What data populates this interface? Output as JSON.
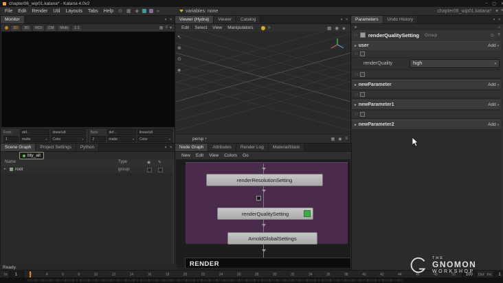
{
  "icons": {
    "minimize": "–",
    "maximize": "▢",
    "close": "✕",
    "menu": "≡",
    "dropdown": "▾",
    "expand": "▸",
    "chevrons": "»",
    "grid": "▦",
    "target": "◉",
    "diamond": "◈",
    "select_arrow": "↖",
    "plus": "⊕",
    "circle_dot": "⊙",
    "grip": "∷",
    "pencil": "✎"
  },
  "window": {
    "title": "chapter06_wip01.katana* - Katana 4.0v2"
  },
  "menubar": {
    "items": [
      "File",
      "Edit",
      "Render",
      "Util",
      "Layouts",
      "Tabs",
      "Help"
    ],
    "variables_label": "variables: none",
    "project_label": "chapter06_wip01.katana*"
  },
  "monitor": {
    "tab": "Monitor",
    "buttons": [
      "2D",
      "3D",
      "ROI",
      "CM",
      "Multi",
      "1:1"
    ],
    "front": {
      "label": "Front",
      "frame": "1",
      "view": "def...",
      "colorspace": "linear/u8",
      "matte": "matte",
      "color": "Color"
    },
    "back": {
      "label": "Back",
      "frame": "2",
      "view": "def...",
      "colorspace": "linear/u8",
      "matte": "matte",
      "color": "Color"
    }
  },
  "viewer": {
    "tabs": [
      "Viewer (Hydra)",
      "Viewer",
      "Catalog"
    ],
    "menu": [
      "Edit",
      "Select",
      "View",
      "Manipulators"
    ],
    "camera": "persp"
  },
  "scenegraph": {
    "tabs": [
      "Scene Graph",
      "Project Settings",
      "Python"
    ],
    "filter": "bty_all",
    "col_name": "Name",
    "col_type": "Type",
    "root": {
      "name": "root",
      "type": "group"
    }
  },
  "nodegraph": {
    "tabs": [
      "Node Graph",
      "Attributes",
      "Render Log",
      "MaterialStack"
    ],
    "menu": [
      "New",
      "Edit",
      "View",
      "Colors",
      "Go"
    ],
    "nodes": [
      "renderResolutionSetting",
      "renderQualitySetting",
      "ArnoldGlobalSettings"
    ],
    "render_label": "RENDER"
  },
  "parameters": {
    "tabs": [
      "Parameters",
      "Undo History"
    ],
    "node_name": "renderQualitySetting",
    "node_type": "Group",
    "groups": [
      {
        "label": "user",
        "action": "Add"
      },
      {
        "label": "newParameter",
        "action": "Add"
      },
      {
        "label": "newParameter1",
        "action": "Add"
      },
      {
        "label": "newParameter2",
        "action": "Add"
      }
    ],
    "renderQuality": {
      "label": "renderQuality",
      "value": "high"
    }
  },
  "status": {
    "message": "Ready."
  },
  "timeline": {
    "in_label": "In",
    "in_value": "1",
    "out_label": "Out",
    "out_value": "100",
    "inc_label": "Inc",
    "inc_value": "1",
    "ticks": [
      "2",
      "4",
      "6",
      "8",
      "10",
      "12",
      "14",
      "16",
      "18",
      "20",
      "22",
      "24",
      "26",
      "28",
      "30",
      "32",
      "34",
      "36",
      "38",
      "40",
      "42",
      "44",
      "46",
      "48",
      "50"
    ]
  },
  "watermark": {
    "line1": "THE",
    "line2": "GNOMON",
    "line3": "WORKSHOP"
  },
  "colors": {
    "accent": "#e8821e",
    "backdrop": "#4a2b4c",
    "node": "#b9b9b9",
    "flag_green": "#3fa84b"
  }
}
